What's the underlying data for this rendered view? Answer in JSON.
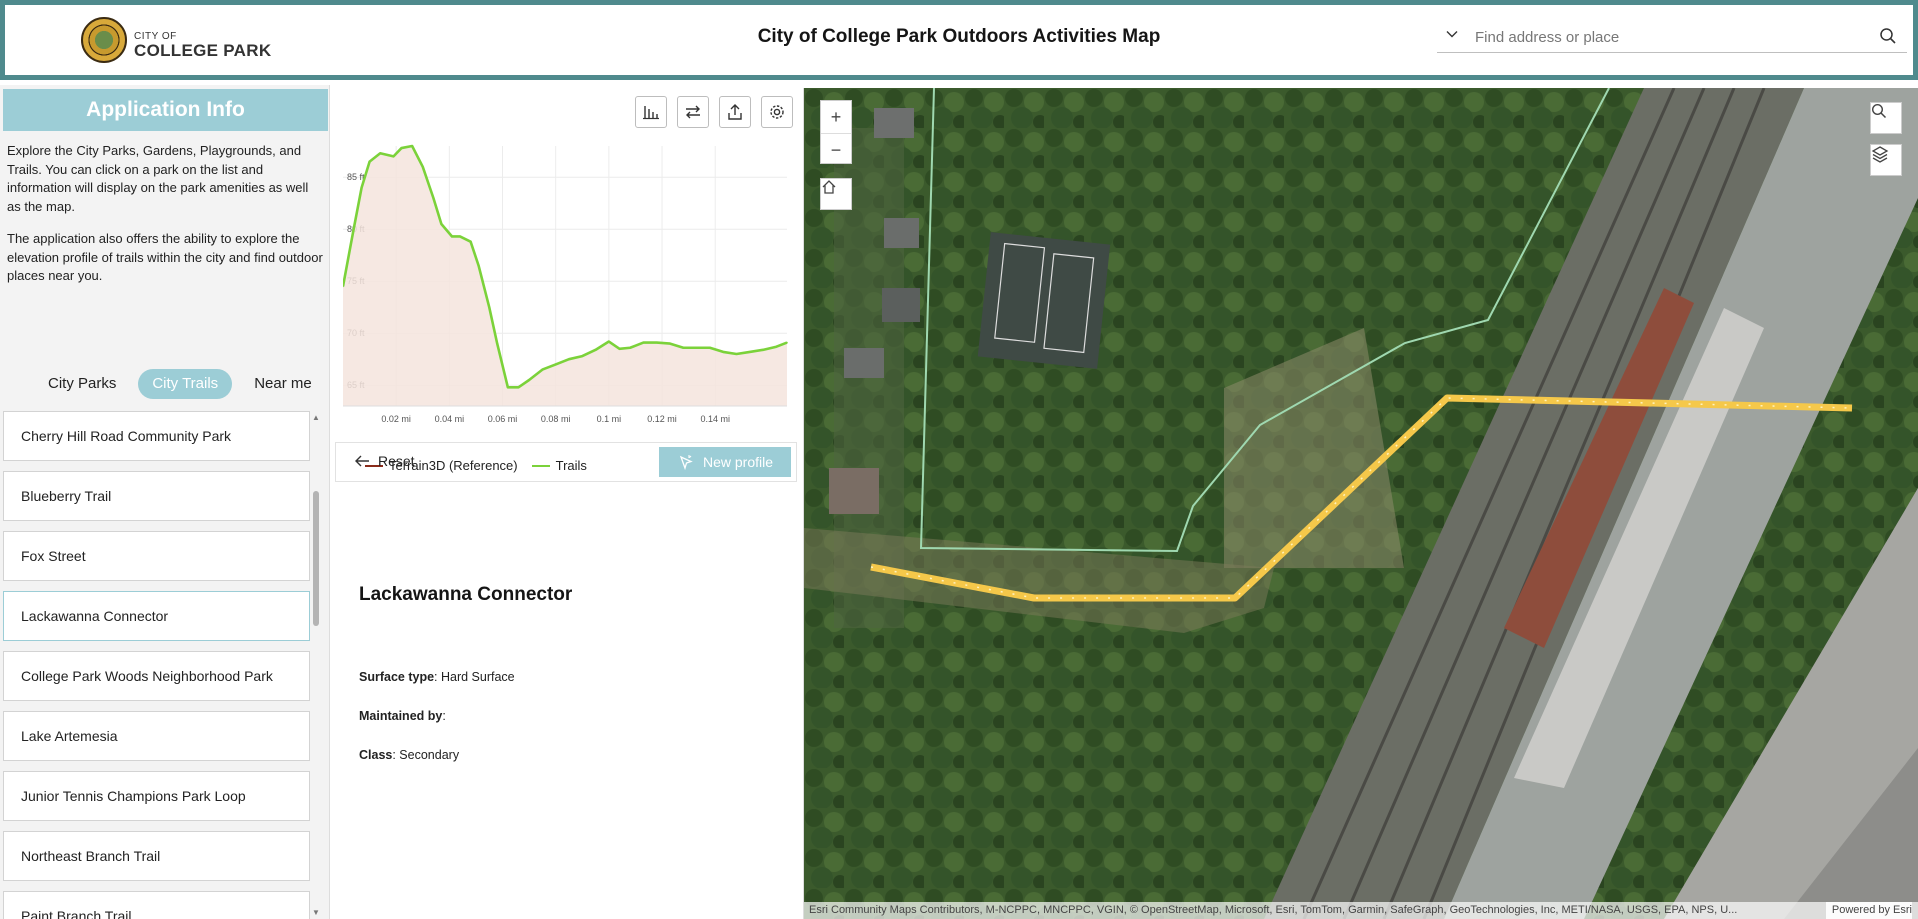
{
  "header": {
    "logo_small": "CITY OF",
    "logo_big": "COLLEGE PARK",
    "title": "City of College Park Outdoors Activities Map",
    "search_placeholder": "Find address or place"
  },
  "info": {
    "title": "Application Info",
    "paragraph1": "Explore the City Parks, Gardens, Playgrounds, and Trails. You can click on a park on the list and information will display on the park amenities as well as the map.",
    "paragraph2": "The application also offers the ability to explore the elevation profile of trails within the city and find outdoor places near you."
  },
  "tabs": [
    {
      "label": "City Parks",
      "active": false
    },
    {
      "label": "City Trails",
      "active": true
    },
    {
      "label": "Near me",
      "active": false
    }
  ],
  "list": [
    "Cherry Hill Road Community Park",
    "Blueberry Trail",
    "Fox Street",
    "Lackawanna Connector",
    "College Park Woods Neighborhood Park",
    "Lake Artemesia",
    "Junior Tennis Champions Park Loop",
    "Northeast Branch Trail",
    "Paint Branch Trail"
  ],
  "selected_item": "Lackawanna Connector",
  "profile": {
    "legend": [
      {
        "label": "Terrain3D (Reference)",
        "color": "#8a2b1a"
      },
      {
        "label": "Trails",
        "color": "#7bd23a"
      }
    ],
    "reset_label": "Reset",
    "new_profile_label": "New profile"
  },
  "chart_data": {
    "type": "area",
    "x_ticks": [
      "0.02 mi",
      "0.04 mi",
      "0.06 mi",
      "0.08 mi",
      "0.1 mi",
      "0.12 mi",
      "0.14 mi"
    ],
    "y_ticks": [
      "85 ft",
      "80 ft",
      "75 ft",
      "70 ft",
      "65 ft"
    ],
    "ylim": [
      63,
      88
    ],
    "xlim": [
      0,
      0.167
    ],
    "series": [
      {
        "name": "Trails",
        "x": [
          0,
          0.004,
          0.007,
          0.01,
          0.014,
          0.019,
          0.022,
          0.026,
          0.03,
          0.034,
          0.037,
          0.041,
          0.044,
          0.048,
          0.051,
          0.055,
          0.058,
          0.062,
          0.066,
          0.07,
          0.075,
          0.08,
          0.085,
          0.09,
          0.095,
          0.1,
          0.104,
          0.108,
          0.113,
          0.118,
          0.123,
          0.128,
          0.133,
          0.138,
          0.143,
          0.148,
          0.153,
          0.158,
          0.163,
          0.167
        ],
        "y": [
          74.5,
          80,
          84,
          86.5,
          87.3,
          87,
          87.8,
          88,
          86,
          83,
          80.5,
          79.3,
          79.3,
          78.8,
          76.5,
          72.5,
          69,
          64.8,
          64.8,
          65.5,
          66.5,
          67,
          67.5,
          67.8,
          68.4,
          69.2,
          68.5,
          68.6,
          69.1,
          69.1,
          69,
          68.6,
          68.6,
          68.6,
          68.2,
          68,
          68.2,
          68.4,
          68.7,
          69.1
        ]
      },
      {
        "name": "Terrain3D (Reference)",
        "x": [
          0,
          0.004,
          0.007,
          0.01,
          0.014,
          0.019,
          0.022,
          0.026,
          0.03,
          0.034,
          0.037,
          0.041,
          0.044,
          0.048,
          0.051,
          0.055,
          0.058,
          0.062,
          0.066,
          0.07,
          0.075,
          0.08,
          0.085,
          0.09,
          0.095,
          0.1,
          0.104,
          0.108,
          0.113,
          0.118,
          0.123,
          0.128,
          0.133,
          0.138,
          0.143,
          0.148,
          0.153,
          0.158,
          0.163,
          0.167
        ],
        "y": [
          74.5,
          80,
          84,
          86.5,
          87.3,
          87,
          87.8,
          88,
          86,
          83,
          80.5,
          79.3,
          79.3,
          78.8,
          76.5,
          72.5,
          69,
          64.8,
          64.8,
          65.5,
          66.5,
          67,
          67.5,
          67.8,
          68.4,
          69.2,
          68.5,
          68.6,
          69.1,
          69.1,
          69,
          68.6,
          68.6,
          68.6,
          68.2,
          68,
          68.2,
          68.4,
          68.7,
          69.1
        ]
      }
    ],
    "grid": true
  },
  "feature": {
    "title": "Lackawanna Connector",
    "surface_label": "Surface type",
    "surface_value": ": Hard Surface",
    "maintained_label": "Maintained by",
    "maintained_value": ":",
    "class_label": "Class",
    "class_value": ": Secondary"
  },
  "map": {
    "zoom_in": "+",
    "zoom_out": "−",
    "attribution": "Esri Community Maps Contributors, M-NCPPC, MNCPPC, VGIN, © OpenStreetMap, Microsoft, Esri, TomTom, Garmin, SafeGraph, GeoTechnologies, Inc, METI/NASA, USGS, EPA, NPS, U...",
    "powered": "Powered by Esri",
    "trail_color": "#f5c84a"
  }
}
